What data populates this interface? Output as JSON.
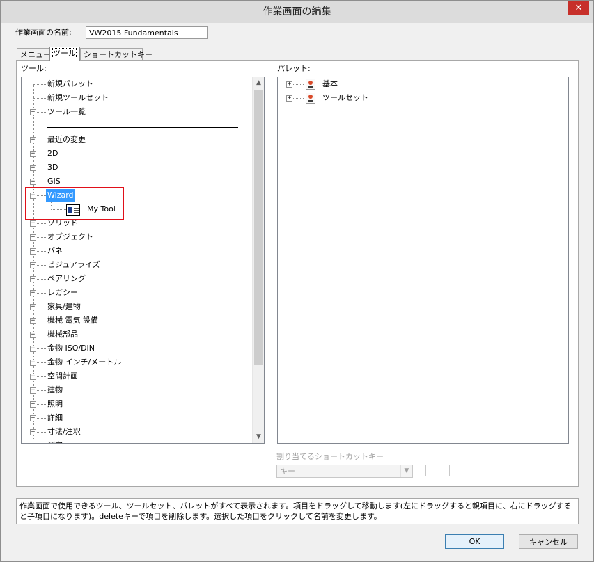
{
  "window": {
    "title": "作業画面の編集",
    "close_label": "✕"
  },
  "name_field": {
    "label": "作業画面の名前:",
    "value": "VW2015 Fundamentals"
  },
  "tabs": [
    {
      "label": "メニュー"
    },
    {
      "label": "ツール"
    },
    {
      "label": "ショートカットキー"
    }
  ],
  "tools_panel": {
    "label": "ツール:",
    "items": [
      {
        "label": "新規パレット",
        "expander": ""
      },
      {
        "label": "新規ツールセット",
        "expander": ""
      },
      {
        "label": "ツール一覧",
        "expander": "+"
      },
      {
        "label": "最近の変更",
        "expander": "+"
      },
      {
        "label": "2D",
        "expander": "+"
      },
      {
        "label": "3D",
        "expander": "+"
      },
      {
        "label": "GIS",
        "expander": "+"
      },
      {
        "label": "Wizard",
        "expander": "−"
      },
      {
        "label": "My Tool",
        "expander": ""
      },
      {
        "label": "ソリッド",
        "expander": "+"
      },
      {
        "label": "オブジェクト",
        "expander": "+"
      },
      {
        "label": "パネ",
        "expander": "+"
      },
      {
        "label": "ビジュアライズ",
        "expander": "+"
      },
      {
        "label": "ベアリング",
        "expander": "+"
      },
      {
        "label": "レガシー",
        "expander": "+"
      },
      {
        "label": "家具/建物",
        "expander": "+"
      },
      {
        "label": "機械 電気 設備",
        "expander": "+"
      },
      {
        "label": "機械部品",
        "expander": "+"
      },
      {
        "label": "金物 ISO/DIN",
        "expander": "+"
      },
      {
        "label": "金物 インチ/メートル",
        "expander": "+"
      },
      {
        "label": "空間計画",
        "expander": "+"
      },
      {
        "label": "建物",
        "expander": "+"
      },
      {
        "label": "照明",
        "expander": "+"
      },
      {
        "label": "詳細",
        "expander": "+"
      },
      {
        "label": "寸法/注釈",
        "expander": "+"
      },
      {
        "label": "測定",
        "expander": "+"
      }
    ]
  },
  "palettes_panel": {
    "label": "パレット:",
    "items": [
      {
        "label": "基本",
        "expander": "+"
      },
      {
        "label": "ツールセット",
        "expander": "+"
      }
    ]
  },
  "shortcut": {
    "label": "割り当てるショートカットキー",
    "select_value": "キー",
    "key_value": ""
  },
  "help_text": "作業画面で使用できるツール、ツールセット、パレットがすべて表示されます。項目をドラッグして移動します(左にドラッグすると親項目に、右にドラッグすると子項目になります)。deleteキーで項目を削除します。選択した項目をクリックして名前を変更します。",
  "buttons": {
    "ok": "OK",
    "cancel": "キャンセル"
  }
}
